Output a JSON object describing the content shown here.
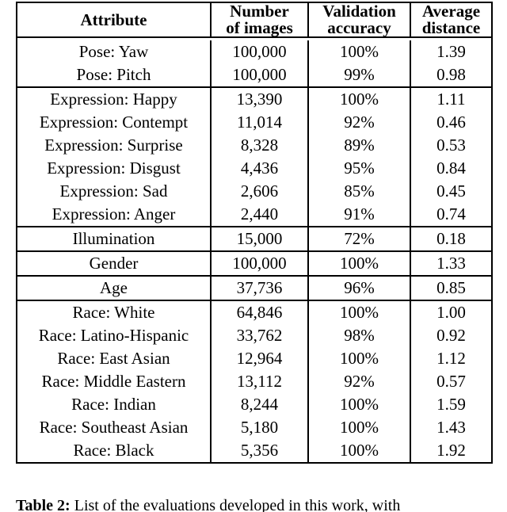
{
  "table": {
    "columns": [
      {
        "id": "attribute",
        "label_lines": [
          "Attribute"
        ]
      },
      {
        "id": "number_of_images",
        "label_lines": [
          "Number",
          "of images"
        ]
      },
      {
        "id": "validation_accuracy",
        "label_lines": [
          "Validation",
          "accuracy"
        ]
      },
      {
        "id": "average_distance",
        "label_lines": [
          "Average",
          "distance"
        ]
      }
    ],
    "groups": [
      {
        "name": "pose",
        "rows": [
          {
            "attribute": "Pose: Yaw",
            "number_of_images": "100,000",
            "validation_accuracy": "100%",
            "average_distance": "1.39"
          },
          {
            "attribute": "Pose: Pitch",
            "number_of_images": "100,000",
            "validation_accuracy": "99%",
            "average_distance": "0.98"
          }
        ]
      },
      {
        "name": "expression",
        "rows": [
          {
            "attribute": "Expression: Happy",
            "number_of_images": "13,390",
            "validation_accuracy": "100%",
            "average_distance": "1.11"
          },
          {
            "attribute": "Expression: Contempt",
            "number_of_images": "11,014",
            "validation_accuracy": "92%",
            "average_distance": "0.46"
          },
          {
            "attribute": "Expression: Surprise",
            "number_of_images": "8,328",
            "validation_accuracy": "89%",
            "average_distance": "0.53"
          },
          {
            "attribute": "Expression: Disgust",
            "number_of_images": "4,436",
            "validation_accuracy": "95%",
            "average_distance": "0.84"
          },
          {
            "attribute": "Expression: Sad",
            "number_of_images": "2,606",
            "validation_accuracy": "85%",
            "average_distance": "0.45"
          },
          {
            "attribute": "Expression: Anger",
            "number_of_images": "2,440",
            "validation_accuracy": "91%",
            "average_distance": "0.74"
          }
        ]
      },
      {
        "name": "illumination",
        "rows": [
          {
            "attribute": "Illumination",
            "number_of_images": "15,000",
            "validation_accuracy": "72%",
            "average_distance": "0.18"
          }
        ]
      },
      {
        "name": "gender",
        "rows": [
          {
            "attribute": "Gender",
            "number_of_images": "100,000",
            "validation_accuracy": "100%",
            "average_distance": "1.33"
          }
        ]
      },
      {
        "name": "age",
        "rows": [
          {
            "attribute": "Age",
            "number_of_images": "37,736",
            "validation_accuracy": "96%",
            "average_distance": "0.85"
          }
        ]
      },
      {
        "name": "race",
        "rows": [
          {
            "attribute": "Race: White",
            "number_of_images": "64,846",
            "validation_accuracy": "100%",
            "average_distance": "1.00"
          },
          {
            "attribute": "Race: Latino-Hispanic",
            "number_of_images": "33,762",
            "validation_accuracy": "98%",
            "average_distance": "0.92"
          },
          {
            "attribute": "Race: East Asian",
            "number_of_images": "12,964",
            "validation_accuracy": "100%",
            "average_distance": "1.12"
          },
          {
            "attribute": "Race: Middle Eastern",
            "number_of_images": "13,112",
            "validation_accuracy": "92%",
            "average_distance": "0.57"
          },
          {
            "attribute": "Race: Indian",
            "number_of_images": "8,244",
            "validation_accuracy": "100%",
            "average_distance": "1.59"
          },
          {
            "attribute": "Race: Southeast Asian",
            "number_of_images": "5,180",
            "validation_accuracy": "100%",
            "average_distance": "1.43"
          },
          {
            "attribute": "Race: Black",
            "number_of_images": "5,356",
            "validation_accuracy": "100%",
            "average_distance": "1.92"
          }
        ]
      }
    ]
  },
  "caption": {
    "label": "Table 2:",
    "text": "List of the evaluations developed in this work, with"
  },
  "colors": {
    "text": "#000000",
    "rule": "#000000",
    "background": "#ffffff"
  }
}
